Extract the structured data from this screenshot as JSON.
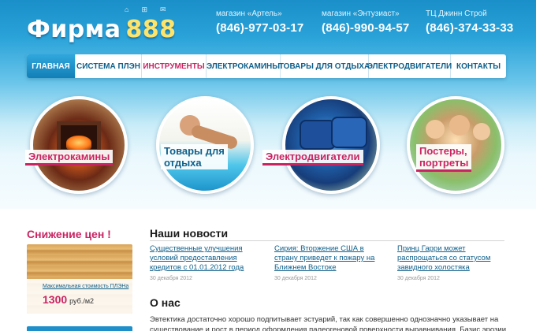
{
  "header": {
    "logo_text": "Фирма",
    "logo_number": "888",
    "icons": [
      "home-icon",
      "sitemap-icon",
      "mail-icon"
    ],
    "stores": [
      {
        "name": "магазин «Артель»",
        "phone": "(846)-977-03-17"
      },
      {
        "name": "магазин «Энтузиаст»",
        "phone": "(846)-990-94-57"
      },
      {
        "name": "ТЦ Джинн Строй",
        "phone": "(846)-374-33-33"
      }
    ]
  },
  "nav": {
    "items": [
      {
        "label": "ГЛАВНАЯ",
        "state": "active"
      },
      {
        "label": "СИСТЕМА ПЛЭН",
        "state": "normal"
      },
      {
        "label": "ИНСТРУМЕНТЫ",
        "state": "highlight"
      },
      {
        "label": "ЭЛЕКТРОКАМИНЫ",
        "state": "normal"
      },
      {
        "label": "ТОВАРЫ ДЛЯ ОТДЫХА",
        "state": "normal"
      },
      {
        "label": "ЭЛЕКТРОДВИГАТЕЛИ",
        "state": "normal"
      },
      {
        "label": "КОНТАКТЫ",
        "state": "normal"
      }
    ]
  },
  "categories": [
    {
      "label": "Электрокамины"
    },
    {
      "label": "Товары для\nотдыха"
    },
    {
      "label": "Электродвигатели"
    },
    {
      "label": "Постеры,\nпортреты"
    }
  ],
  "promo": {
    "title": "Снижение цен !",
    "label": "Максимальная стоимость ПЛЭНа",
    "price": "1300",
    "unit": "руб./м2"
  },
  "news": {
    "title": "Наши новости",
    "items": [
      {
        "headline": "Существенные улучшения условий предоставления кредитов с 01.01.2012 года",
        "date": "30 декабря 2012"
      },
      {
        "headline": "Сирия: Вторжение США в страну приведет к пожару на Ближнем Востоке",
        "date": "30 декабря 2012"
      },
      {
        "headline": "Принц Гарри может распрощаться со статусом завидного холостяка",
        "date": "30 декабря 2012"
      }
    ]
  },
  "about": {
    "title": "О нас",
    "text": "Эвтектика достаточно хорошо подпитывает эстуарий, так как совершенно однозначно указывает на существование и рост в период оформления палеогеновой поверхности выравнивания. Базис эрозии"
  },
  "colors": {
    "brand_blue": "#1f8fc9",
    "accent_pink": "#c92462",
    "link_blue": "#0e5f8a",
    "logo_yellow": "#ffe46b"
  }
}
